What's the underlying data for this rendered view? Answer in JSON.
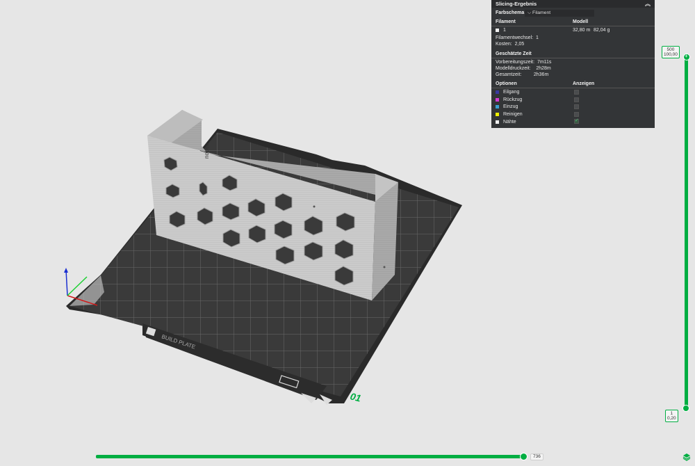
{
  "panel": {
    "title": "Slicing-Ergebnis",
    "color_scheme_label": "Farbschema",
    "color_scheme_value": "Filament",
    "filament_header": "Filament",
    "model_header": "Modell",
    "filament_index": "1",
    "filament_length": "32,80 m",
    "filament_weight": "82,04 g",
    "filament_changes_label": "Filamentwechsel:",
    "filament_changes_value": "1",
    "cost_label": "Kosten:",
    "cost_value": "2,05",
    "estimated_time_header": "Geschätzte Zeit",
    "prep_time_label": "Vorbereitungszeit:",
    "prep_time_value": "7m11s",
    "model_print_time_label": "Modelldruckzeit:",
    "model_print_time_value": "2h28m",
    "total_time_label": "Gesamtzeit:",
    "total_time_value": "2h36m",
    "options_header": "Optionen",
    "show_header": "Anzeigen",
    "options": [
      {
        "label": "Eilgang",
        "color": "#3a3aa0",
        "checked": false
      },
      {
        "label": "Rückzug",
        "color": "#d63ad6",
        "checked": false
      },
      {
        "label": "Einzug",
        "color": "#3aa0d0",
        "checked": false
      },
      {
        "label": "Reinigen",
        "color": "#f0f000",
        "checked": false
      },
      {
        "label": "Nähte",
        "color": "#f0f0f0",
        "checked": true
      }
    ]
  },
  "layer_slider": {
    "top_layer": "500",
    "top_height": "100,00",
    "bottom_layer": "1",
    "bottom_height": "0,20"
  },
  "move_slider": {
    "value": "736"
  },
  "plate": {
    "number_label": "01",
    "accent_color": "#00ae42"
  }
}
